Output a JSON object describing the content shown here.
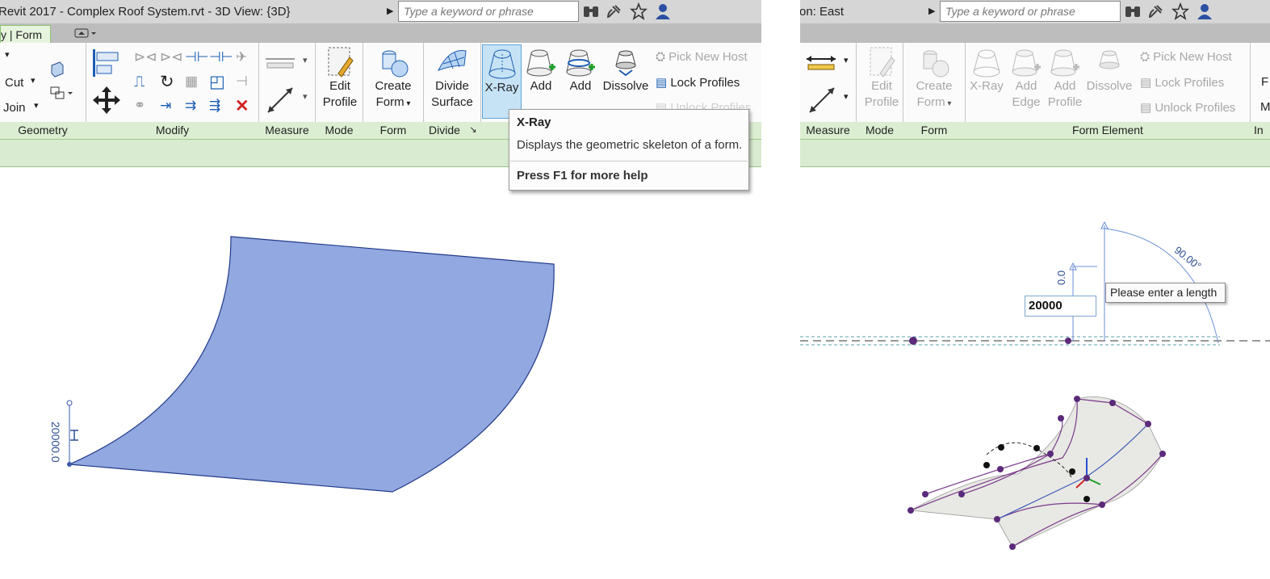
{
  "left": {
    "window_title": "Revit 2017 -     Complex Roof System.rvt - 3D View: {3D}",
    "search_placeholder": "Type a keyword or phrase",
    "context_tab": "y | Form",
    "ribbon": {
      "geometry": {
        "cut": "Cut",
        "join": "Join"
      },
      "buttons": {
        "edit_profile": [
          "Edit",
          "Profile"
        ],
        "create_form": [
          "Create",
          "Form"
        ],
        "divide_surface": [
          "Divide",
          "Surface"
        ],
        "xray": "X-Ray",
        "add_edge": "Add",
        "add_profile": "Add",
        "dissolve": "Dissolve",
        "pick_new_host": "Pick  New Host",
        "lock_profiles": "Lock  Profiles",
        "unlock_profiles": "Unlock  Profiles"
      },
      "panel_labels": {
        "geometry": "Geometry",
        "modify": "Modify",
        "measure": "Measure",
        "mode": "Mode",
        "form": "Form",
        "divide": "Divide"
      }
    },
    "tooltip": {
      "title": "X-Ray",
      "description": "Displays the geometric skeleton of a form.",
      "help": "Press F1 for more help"
    },
    "dimension": "20000.0",
    "surface_color": "#91a8e0"
  },
  "right": {
    "window_title": "on: East",
    "search_placeholder": "Type a keyword or phrase",
    "ribbon": {
      "buttons": {
        "edit_profile": [
          "Edit",
          "Profile"
        ],
        "create_form": [
          "Create",
          "Form"
        ],
        "xray": "X-Ray",
        "add_edge": [
          "Add",
          "Edge"
        ],
        "add_profile": [
          "Add",
          "Profile"
        ],
        "dissolve": "Dissolve",
        "pick_new_host": "Pick  New Host",
        "lock_profiles": "Lock  Profiles",
        "unlock_profiles": "Unlock  Profiles",
        "cut_off": "F",
        "cut_off2": "M"
      },
      "panel_labels": {
        "measure": "Measure",
        "mode": "Mode",
        "form": "Form",
        "form_element": "Form Element",
        "cut_off": "In"
      }
    },
    "angle": "90.00°",
    "dim_partial": "0.0",
    "length_value": "20000",
    "length_tip": "Please enter a length"
  },
  "colors": {
    "accent_green": "#8cc276",
    "selection_blue": "#5ea3d6",
    "profile_purple": "#6a2a7a"
  }
}
